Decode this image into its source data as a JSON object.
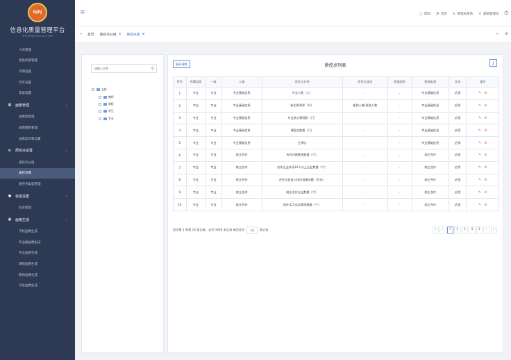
{
  "app": {
    "logo_text": "DJPJ",
    "brand_title": "信息化质量管理平台",
    "brand_subtitle": "INFORMATION SYSTEM"
  },
  "sidebar": {
    "items": [
      {
        "type": "item",
        "label": "人员管理"
      },
      {
        "type": "item",
        "label": "角色权限管理"
      },
      {
        "type": "item",
        "label": "学期设置"
      },
      {
        "type": "item",
        "label": "学年设置"
      },
      {
        "type": "item",
        "label": "年级设置"
      },
      {
        "type": "group",
        "label": "画像管理",
        "icon": "grid-icon"
      },
      {
        "type": "item",
        "label": "画像类管理"
      },
      {
        "type": "item",
        "label": "画像模板管理"
      },
      {
        "type": "item",
        "label": "画像类对象设置"
      },
      {
        "type": "group",
        "label": "质控点设置",
        "icon": "gear-icon"
      },
      {
        "type": "item",
        "label": "质控点分组"
      },
      {
        "type": "item",
        "label": "质控点库",
        "active": true
      },
      {
        "type": "item",
        "label": "质控点类型管理"
      },
      {
        "type": "group",
        "label": "标签设置",
        "icon": "dot-icon"
      },
      {
        "type": "item",
        "label": "标签管理"
      },
      {
        "type": "group",
        "label": "画像生成",
        "icon": "image-icon"
      },
      {
        "type": "item",
        "label": "学校画像生成"
      },
      {
        "type": "item",
        "label": "专业群画像生成"
      },
      {
        "type": "item",
        "label": "专业画像生成"
      },
      {
        "type": "item",
        "label": "课程画像生成"
      },
      {
        "type": "item",
        "label": "教师画像生成"
      },
      {
        "type": "item",
        "label": "学生画像生成"
      }
    ]
  },
  "header": {
    "help": "帮助",
    "message": "消息",
    "role": "管理员角色",
    "user": "超级管理员"
  },
  "tabs": [
    {
      "label": "首页",
      "closable": false,
      "active": false
    },
    {
      "label": "质控点分组",
      "closable": true,
      "active": false
    },
    {
      "label": "质控点库",
      "closable": true,
      "active": true
    }
  ],
  "tree": {
    "search_placeholder": "请输入名称",
    "nodes": [
      {
        "label": "全部",
        "level": 0
      },
      {
        "label": "教师",
        "level": 1
      },
      {
        "label": "课程",
        "level": 1
      },
      {
        "label": "学生",
        "level": 1
      },
      {
        "label": "专业",
        "level": 1
      }
    ]
  },
  "table": {
    "expand_button": "展开搜索",
    "title": "质控点列表",
    "export_icon": "download-icon",
    "columns": [
      "序号",
      "所属层面",
      "一级",
      "二级",
      "质控点名称",
      "质控点描述",
      "数据规则",
      "数据来源",
      "状态",
      "操作"
    ],
    "rows": [
      [
        "1",
        "专业",
        "专业",
        "专业基础信息",
        "专业人数（人）",
        "-",
        "-",
        "专业基础信息",
        "启用"
      ],
      [
        "2",
        "专业",
        "专业",
        "专业基础信息",
        "新生报到率（%）",
        "报到人数/录取人数",
        "-",
        "专业基础信息",
        "启用"
      ],
      [
        "3",
        "专业",
        "专业",
        "专业基础信息",
        "专业核心课程数（门）",
        "-",
        "-",
        "专业基础信息",
        "启用"
      ],
      [
        "4",
        "专业",
        "专业",
        "专业基础信息",
        "课程总数量（门）",
        "-",
        "-",
        "专业基础信息",
        "启用"
      ],
      [
        "5",
        "专业",
        "专业",
        "专业基础信息",
        "生师比",
        "-",
        "-",
        "专业基础信息",
        "启用"
      ],
      [
        "6",
        "专业",
        "专业",
        "校企合作",
        "合作共建基地数量（个）",
        "-",
        "-",
        "校企合作",
        "启用"
      ],
      [
        "7",
        "专业",
        "专业",
        "校企合作",
        "合作企业年接10人以上企业数量（个）",
        "-",
        "-",
        "校企合作",
        "启用"
      ],
      [
        "8",
        "专业",
        "专业",
        "校企合作",
        "合作企业投入校内设备总额（万元）",
        "-",
        "-",
        "校企合作",
        "启用"
      ],
      [
        "9",
        "专业",
        "专业",
        "校企合作",
        "校企合作企业数量（个）",
        "-",
        "-",
        "校企合作",
        "启用"
      ],
      [
        "10",
        "专业",
        "专业",
        "校企合作",
        "校外实习实训基地数量（个）",
        "-",
        "-",
        "校企合作",
        "启用"
      ]
    ]
  },
  "pagination": {
    "info_prefix": "显示第 1 到第 10 条记录，总共 1659 条记录 每页显示",
    "page_size": "10",
    "info_suffix": "条记录",
    "pages": [
      "«",
      "‹",
      "1",
      "2",
      "3",
      "4",
      "5",
      "›",
      "»"
    ],
    "current_page": "1"
  }
}
